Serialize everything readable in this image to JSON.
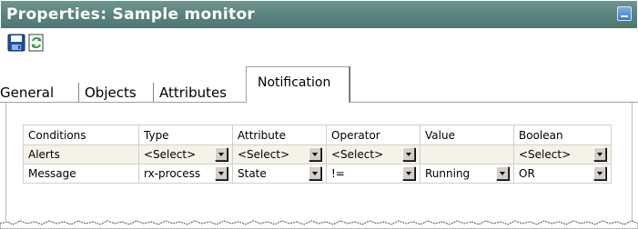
{
  "window": {
    "title": "Properties: Sample monitor",
    "title_button_icon": "minimize-icon"
  },
  "toolbar": {
    "save_icon": "save-icon",
    "refresh_icon": "refresh-icon"
  },
  "tabs": {
    "general": "General",
    "objects": "Objects",
    "attributes": "Attributes",
    "notification": "Notification",
    "active": "Notification"
  },
  "conditions_table": {
    "headers": [
      "Conditions",
      "Type",
      "Attribute",
      "Operator",
      "Value",
      "Boolean"
    ],
    "rows": [
      {
        "label": "Alerts",
        "type": "<Select>",
        "attribute": "<Select>",
        "operator": "<Select>",
        "value": "",
        "boolean": "<Select>"
      },
      {
        "label": "Message",
        "type": "rx-process",
        "attribute": "State",
        "operator": "!=",
        "value": "Running",
        "boolean": "OR"
      }
    ]
  },
  "colors": {
    "titlebar": "#5b837e",
    "row_highlight": "#f6f2e8",
    "save_icon": "#1e4fa8",
    "refresh_icon": "#2e9a3c"
  }
}
